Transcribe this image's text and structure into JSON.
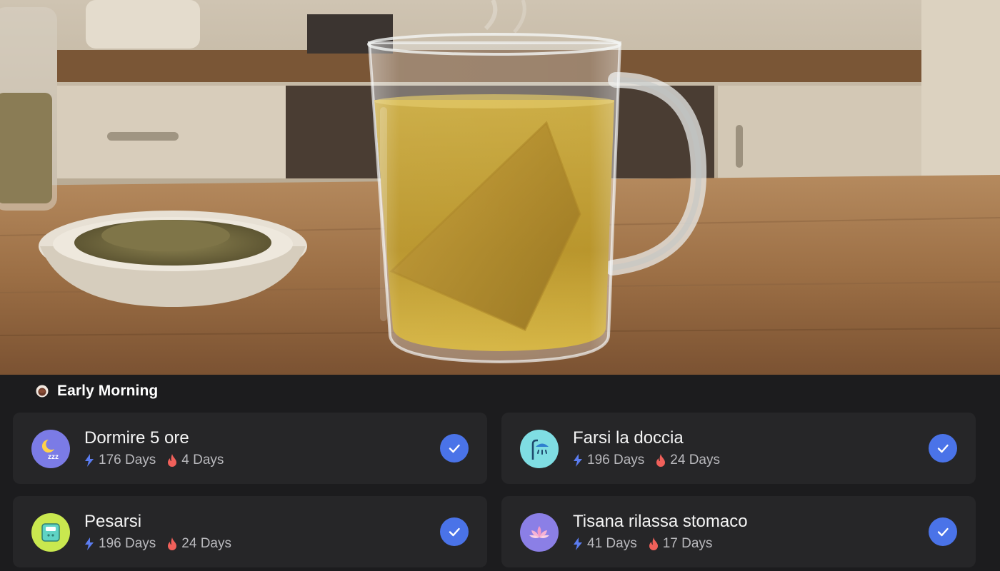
{
  "section": {
    "title": "Early Morning",
    "icon": "coffee-cup-icon"
  },
  "habits": [
    {
      "title": "Dormire 5 ore",
      "icon": "moon-sleep-icon",
      "icon_bg": "#7b7be6",
      "total": "176 Days",
      "streak": "4 Days",
      "completed": true
    },
    {
      "title": "Farsi la doccia",
      "icon": "shower-icon",
      "icon_bg": "#7fdde3",
      "total": "196 Days",
      "streak": "24 Days",
      "completed": true
    },
    {
      "title": "Pesarsi",
      "icon": "scale-icon",
      "icon_bg": "#c9e84f",
      "total": "196 Days",
      "streak": "24 Days",
      "completed": true
    },
    {
      "title": "Tisana rilassa stomaco",
      "icon": "lotus-icon",
      "icon_bg": "#8b7fe6",
      "total": "41 Days",
      "streak": "17 Days",
      "completed": true
    }
  ],
  "colors": {
    "background": "#1c1c1e",
    "card": "#262628",
    "check": "#4a73e8",
    "total_icon": "#5b7cf0",
    "streak_icon": "#f0605a"
  }
}
